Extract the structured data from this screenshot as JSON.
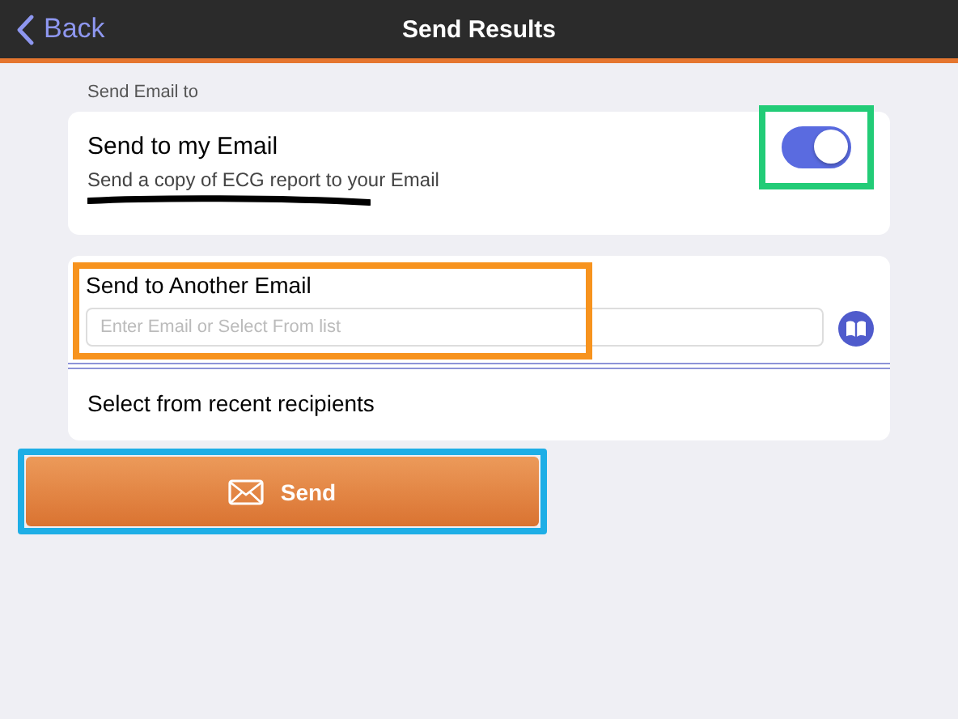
{
  "nav_bar": {
    "back": "Back",
    "title": "Send Results"
  },
  "section_label": "Send Email to",
  "my_email": {
    "title": "Send to my Email",
    "description": "Send a copy of ECG report to your Email",
    "on": true,
    "color": "#22cc77"
  },
  "another_email": {
    "title": "Send to Another Email",
    "placeholder": "Enter Email or Select From list",
    "color": "#f7931e"
  },
  "recent": {
    "label": "Select from recent recipients"
  },
  "send_button": {
    "label": "Send",
    "color": "#1eaee6"
  }
}
